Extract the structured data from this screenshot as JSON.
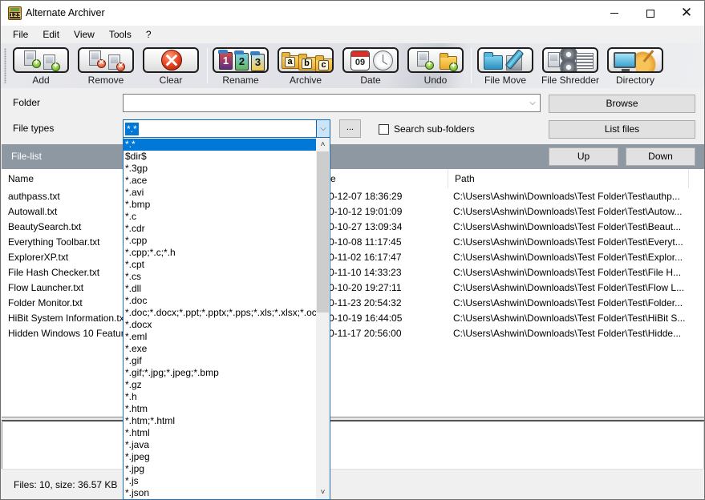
{
  "window": {
    "title": "Alternate Archiver",
    "app_icon_text": "123",
    "controls": {
      "minimize": "minimize",
      "maximize": "maximize",
      "close": "✕"
    }
  },
  "menu": [
    "File",
    "Edit",
    "View",
    "Tools",
    "?"
  ],
  "toolbar": {
    "buttons": [
      {
        "label": "Add",
        "icon": "add-files-icon"
      },
      {
        "label": "Remove",
        "icon": "remove-files-icon"
      },
      {
        "label": "Clear",
        "icon": "clear-icon"
      },
      {
        "label": "Rename",
        "icon": "rename-icon"
      },
      {
        "label": "Archive",
        "icon": "archive-icon"
      },
      {
        "label": "Date",
        "icon": "date-icon"
      },
      {
        "label": "Undo",
        "icon": "undo-icon"
      },
      {
        "label": "File Move",
        "icon": "file-move-icon"
      },
      {
        "label": "File Shredder",
        "icon": "file-shredder-icon"
      },
      {
        "label": "Directory",
        "icon": "directory-icon"
      }
    ],
    "icon_glyphs": {
      "rename": [
        "1",
        "2",
        "3"
      ],
      "archive": [
        "a",
        "b",
        "c"
      ],
      "date_day": "09"
    }
  },
  "form": {
    "folder_label": "Folder",
    "folder_value": "",
    "browse_label": "Browse",
    "file_types_label": "File types",
    "file_types_value": "*.*",
    "ellipsis_label": "...",
    "search_subfolders_label": "Search sub-folders",
    "search_subfolders_checked": false,
    "list_files_label": "List files"
  },
  "file_list": {
    "title": "File-list",
    "up_label": "Up",
    "down_label": "Down",
    "columns": [
      "Name",
      "e",
      "Path"
    ],
    "rows": [
      {
        "name": "authpass.txt",
        "date": "0-12-07 18:36:29",
        "path": "C:\\Users\\Ashwin\\Downloads\\Test Folder\\Test\\authp..."
      },
      {
        "name": "Autowall.txt",
        "date": "0-10-12 19:01:09",
        "path": "C:\\Users\\Ashwin\\Downloads\\Test Folder\\Test\\Autow..."
      },
      {
        "name": "BeautySearch.txt",
        "date": "0-10-27 13:09:34",
        "path": "C:\\Users\\Ashwin\\Downloads\\Test Folder\\Test\\Beaut..."
      },
      {
        "name": "Everything Toolbar.txt",
        "date": "0-10-08 11:17:45",
        "path": "C:\\Users\\Ashwin\\Downloads\\Test Folder\\Test\\Everyt..."
      },
      {
        "name": "ExplorerXP.txt",
        "date": "0-11-02 16:17:47",
        "path": "C:\\Users\\Ashwin\\Downloads\\Test Folder\\Test\\Explor..."
      },
      {
        "name": "File Hash Checker.txt",
        "date": "0-11-10 14:33:23",
        "path": "C:\\Users\\Ashwin\\Downloads\\Test Folder\\Test\\File H..."
      },
      {
        "name": "Flow Launcher.txt",
        "date": "0-10-20 19:27:11",
        "path": "C:\\Users\\Ashwin\\Downloads\\Test Folder\\Test\\Flow L..."
      },
      {
        "name": "Folder Monitor.txt",
        "date": "0-11-23 20:54:32",
        "path": "C:\\Users\\Ashwin\\Downloads\\Test Folder\\Test\\Folder..."
      },
      {
        "name": "HiBit System Information.tx",
        "date": "0-10-19 16:44:05",
        "path": "C:\\Users\\Ashwin\\Downloads\\Test Folder\\Test\\HiBit S..."
      },
      {
        "name": "Hidden Windows 10 Featur",
        "date": "0-11-17 20:56:00",
        "path": "C:\\Users\\Ashwin\\Downloads\\Test Folder\\Test\\Hidde..."
      }
    ]
  },
  "status": {
    "text": "Files: 10, size: 36.57 KB"
  },
  "dropdown": {
    "selected_index": 0,
    "items": [
      "*.*",
      "$dir$",
      "*.3gp",
      "*.ace",
      "*.avi",
      "*.bmp",
      "*.c",
      "*.cdr",
      "*.cpp",
      "*.cpp;*.c;*.h",
      "*.cpt",
      "*.cs",
      "*.dll",
      "*.doc",
      "*.doc;*.docx;*.ppt;*.pptx;*.pps;*.xls;*.xlsx;*.oc",
      "*.docx",
      "*.eml",
      "*.exe",
      "*.gif",
      "*.gif;*.jpg;*.jpeg;*.bmp",
      "*.gz",
      "*.h",
      "*.htm",
      "*.htm;*.html",
      "*.html",
      "*.java",
      "*.jpeg",
      "*.jpg",
      "*.js",
      "*.json"
    ],
    "scroll_up": "˄",
    "scroll_down": "˅"
  },
  "colors": {
    "selection": "#0078d7",
    "filelist_header": "#8e98a3",
    "combo_focus_border": "#0a68b4"
  }
}
